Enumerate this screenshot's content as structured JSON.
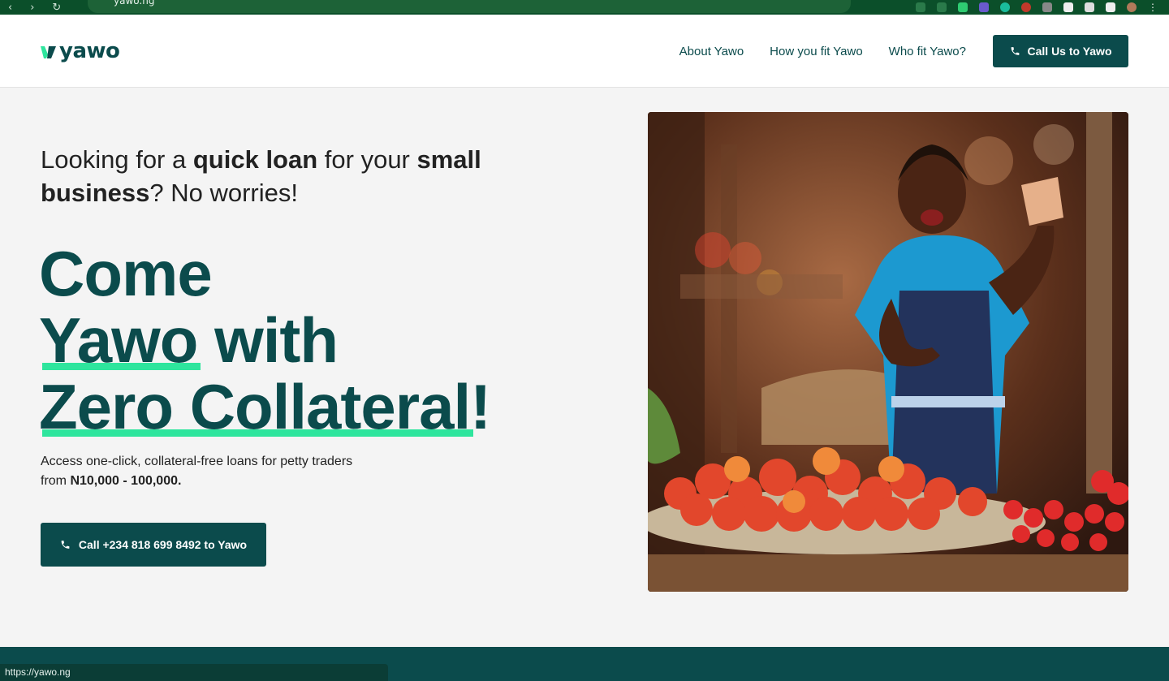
{
  "browser": {
    "url": "yawo.ng",
    "status_url": "https://yawo.ng"
  },
  "header": {
    "logo_text": "yawo",
    "nav": [
      {
        "label": "About Yawo"
      },
      {
        "label": "How you fit Yawo"
      },
      {
        "label": "Who fit Yawo?"
      }
    ],
    "cta_label": "Call Us to Yawo"
  },
  "hero": {
    "tagline": {
      "part1": "Looking for a ",
      "bold1": "quick loan",
      "part2": " for your ",
      "bold2": "small business",
      "part3": "? No worries!"
    },
    "headline": {
      "line1": "Come",
      "line2_hl": "Yawo",
      "line2_rest": " with",
      "line3_hl": "Zero Collateral",
      "line3_rest": "!"
    },
    "subtext": {
      "line1": "Access one-click, collateral-free loans for petty traders",
      "from": "from ",
      "range": "N10,000 - 100,000."
    },
    "cta_label": "Call +234 818 699 8492 to Yawo"
  },
  "colors": {
    "brand": "#0b4b4c",
    "accent": "#2ee59d",
    "browser": "#0b4f2a"
  }
}
